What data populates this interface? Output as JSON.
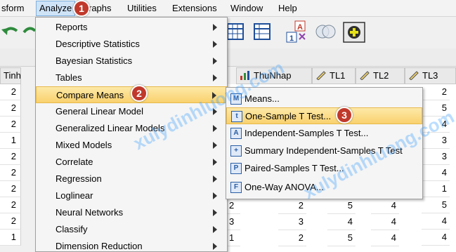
{
  "menubar": {
    "items": [
      "sform",
      "Analyze",
      "raphs",
      "Utilities",
      "Extensions",
      "Window",
      "Help"
    ]
  },
  "grid": {
    "left_header": "Tinh",
    "columns": [
      "ThuNhap",
      "TL1",
      "TL2",
      "TL3"
    ],
    "row_values_left": [
      "2",
      "2",
      "2",
      "1",
      "2",
      "2",
      "2",
      "2",
      "2",
      "2",
      "1",
      "2"
    ],
    "right_col_tl3": [
      "2",
      "5",
      "4",
      "3",
      "3",
      "4",
      "1",
      "5",
      "4",
      "4",
      "4"
    ],
    "lower_rows": [
      {
        "a": "2",
        "b": "2",
        "c": "5",
        "d": "4"
      },
      {
        "a": "3",
        "b": "3",
        "c": "4",
        "d": "4"
      },
      {
        "a": "1",
        "b": "2",
        "c": "5",
        "d": "4"
      },
      {
        "a": "2",
        "b": "2",
        "c": "4",
        "d": "4"
      }
    ]
  },
  "analyze_menu": {
    "items": [
      {
        "label": "Reports"
      },
      {
        "label": "Descriptive Statistics"
      },
      {
        "label": "Bayesian Statistics"
      },
      {
        "label": "Tables"
      },
      {
        "label": "Compare Means"
      },
      {
        "label": "General Linear Model"
      },
      {
        "label": "Generalized Linear Models"
      },
      {
        "label": "Mixed Models"
      },
      {
        "label": "Correlate"
      },
      {
        "label": "Regression"
      },
      {
        "label": "Loglinear"
      },
      {
        "label": "Neural Networks"
      },
      {
        "label": "Classify"
      },
      {
        "label": "Dimension Reduction"
      }
    ]
  },
  "compare_means_menu": {
    "items": [
      {
        "label": "Means...",
        "icon": "M"
      },
      {
        "label": "One-Sample T Test...",
        "icon": "t"
      },
      {
        "label": "Independent-Samples T Test...",
        "icon": "A"
      },
      {
        "label": "Summary Independent-Samples T Test",
        "icon": "+"
      },
      {
        "label": "Paired-Samples T Test...",
        "icon": "P"
      },
      {
        "label": "One-Way ANOVA...",
        "icon": "F"
      }
    ]
  },
  "badges": [
    "1",
    "2",
    "3"
  ],
  "watermarks": [
    "xulydinhluong.com",
    "xulydinhluong.com",
    "xulydinhluong.com"
  ]
}
